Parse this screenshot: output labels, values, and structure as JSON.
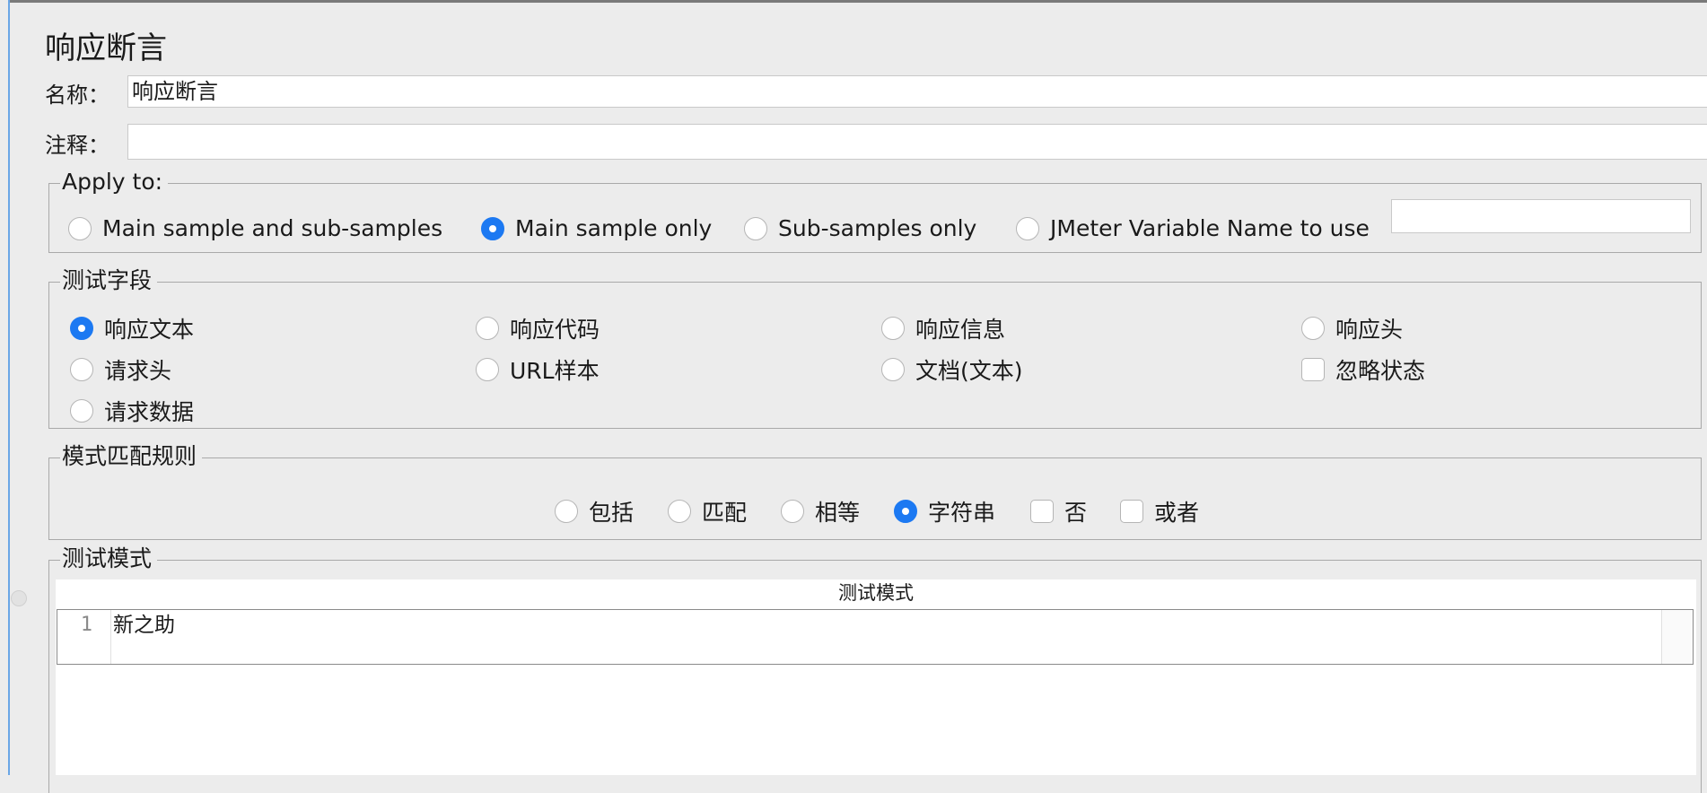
{
  "panel": {
    "title": "响应断言"
  },
  "name_row": {
    "label": "名称：",
    "value": "响应断言"
  },
  "comment_row": {
    "label": "注释：",
    "value": ""
  },
  "apply_to": {
    "legend": "Apply to:",
    "options": [
      {
        "label": "Main sample and sub-samples",
        "checked": false
      },
      {
        "label": "Main sample only",
        "checked": true
      },
      {
        "label": "Sub-samples only",
        "checked": false
      },
      {
        "label": "JMeter Variable Name to use",
        "checked": false
      }
    ],
    "variable_value": ""
  },
  "test_field": {
    "legend": "测试字段",
    "options": [
      {
        "label": "响应文本",
        "type": "radio",
        "checked": true
      },
      {
        "label": "响应代码",
        "type": "radio",
        "checked": false
      },
      {
        "label": "响应信息",
        "type": "radio",
        "checked": false
      },
      {
        "label": "响应头",
        "type": "radio",
        "checked": false
      },
      {
        "label": "请求头",
        "type": "radio",
        "checked": false
      },
      {
        "label": "URL样本",
        "type": "radio",
        "checked": false
      },
      {
        "label": "文档(文本)",
        "type": "radio",
        "checked": false
      },
      {
        "label": "忽略状态",
        "type": "checkbox",
        "checked": false
      },
      {
        "label": "请求数据",
        "type": "radio",
        "checked": false
      }
    ]
  },
  "pattern_rules": {
    "legend": "模式匹配规则",
    "options": [
      {
        "label": "包括",
        "type": "radio",
        "checked": false
      },
      {
        "label": "匹配",
        "type": "radio",
        "checked": false
      },
      {
        "label": "相等",
        "type": "radio",
        "checked": false
      },
      {
        "label": "字符串",
        "type": "radio",
        "checked": true
      },
      {
        "label": "否",
        "type": "checkbox",
        "checked": false
      },
      {
        "label": "或者",
        "type": "checkbox",
        "checked": false
      }
    ]
  },
  "test_patterns": {
    "legend": "测试模式",
    "column_header": "测试模式",
    "rows": [
      {
        "line": "1",
        "text": "新之助"
      }
    ]
  }
}
